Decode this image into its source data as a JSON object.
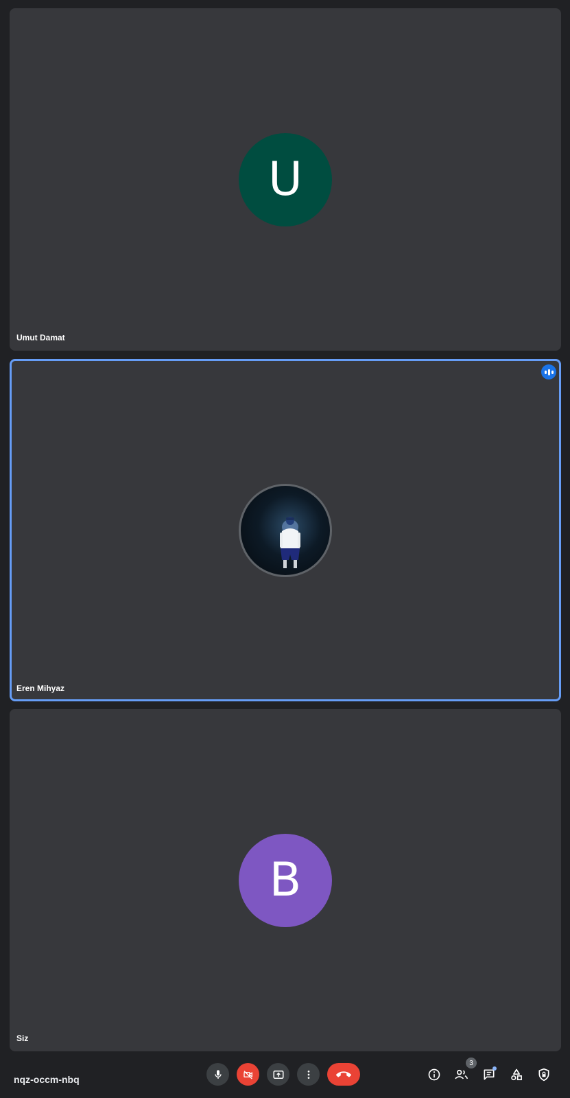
{
  "participants": [
    {
      "name": "Umut Damat",
      "initial": "U",
      "avatar_color": "#004d40",
      "speaking": false
    },
    {
      "name": "Eren Mihyaz",
      "initial": "",
      "avatar_color": "",
      "speaking": true
    },
    {
      "name": "Siz",
      "initial": "B",
      "avatar_color": "#7e57c2",
      "speaking": false
    }
  ],
  "active_speaker_border_color": "#669df6",
  "meeting": {
    "code": "nqz-occm-nbq"
  },
  "controls": {
    "mic": {
      "icon": "mic-icon",
      "state": "on"
    },
    "camera": {
      "icon": "video-off-icon",
      "state": "off"
    },
    "present": {
      "icon": "present-screen-icon"
    },
    "more": {
      "icon": "more-vert-icon"
    },
    "end_call": {
      "icon": "call-end-icon"
    }
  },
  "side_controls": {
    "info_icon": "info-icon",
    "people": {
      "icon": "people-icon",
      "count": "3"
    },
    "chat": {
      "icon": "chat-icon",
      "has_unread": true
    },
    "activities_icon": "activities-icon",
    "host_controls_icon": "shield-lock-icon"
  },
  "colors": {
    "background": "#202124",
    "tile": "#37383c",
    "end_call": "#ea4335",
    "speaking_indicator": "#1a73e8"
  }
}
